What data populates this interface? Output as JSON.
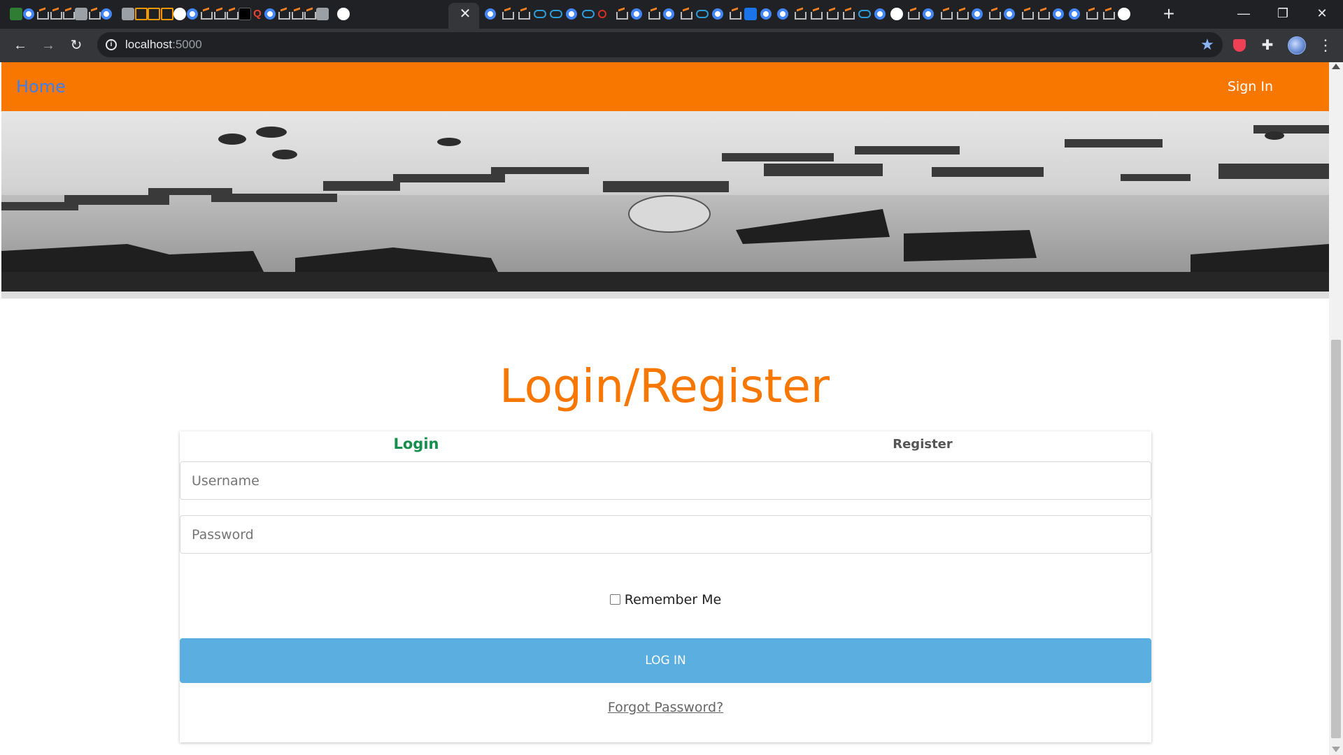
{
  "browser": {
    "url_host": "localhost",
    "url_port": ":5000",
    "tab_close_glyph": "✕",
    "new_tab_glyph": "+",
    "window_controls": {
      "minimize": "—",
      "restore": "❐",
      "close": "✕"
    },
    "toolbar_glyphs": {
      "back": "←",
      "forward": "→",
      "reload": "↻",
      "info": "i",
      "star": "★",
      "extensions": "✚",
      "menu": "⋮"
    }
  },
  "tabs": {
    "favicons": [
      "green-calendar-icon",
      "google-icon",
      "stackoverflow-icon",
      "stackoverflow-icon",
      "stackoverflow-icon",
      "grid-app-icon",
      "stackoverflow-icon",
      "google-icon",
      "arrow-app-icon",
      "orange-arc-icon",
      "hourglass-icon",
      "hourglass-icon",
      "chrome-icon",
      "google-icon",
      "stackoverflow-icon",
      "stackoverflow-icon",
      "stackoverflow-icon",
      "github-icon",
      "quora-icon",
      "google-icon",
      "stackoverflow-icon",
      "stackoverflow-icon",
      "stackoverflow-icon",
      "flag-app-icon",
      "chrome-icon",
      "google-icon",
      "stackoverflow-icon",
      "stackoverflow-icon",
      "link-app-icon",
      "link-app-icon",
      "google-icon",
      "link-app-icon",
      "record-icon",
      "stackoverflow-icon",
      "google-icon",
      "stackoverflow-icon",
      "google-icon",
      "stackoverflow-icon",
      "link-app-icon",
      "google-icon",
      "stackoverflow-icon",
      "cursor-app-icon",
      "google-icon",
      "google-icon",
      "stackoverflow-icon",
      "stackoverflow-icon",
      "stackoverflow-icon",
      "stackoverflow-icon",
      "link-app-icon",
      "google-icon",
      "pocket-app-icon",
      "stackoverflow-icon",
      "google-icon",
      "stackoverflow-icon",
      "stackoverflow-icon",
      "google-icon",
      "stackoverflow-icon",
      "google-icon",
      "stackoverflow-icon",
      "stackoverflow-icon",
      "google-icon",
      "google-icon",
      "stackoverflow-icon",
      "stackoverflow-icon",
      "medium-icon"
    ]
  },
  "nav": {
    "home_label": "Home",
    "signin_label": "Sign In"
  },
  "page": {
    "title": "Login/Register",
    "tabs": {
      "login": "Login",
      "register": "Register"
    },
    "username_placeholder": "Username",
    "password_placeholder": "Password",
    "remember_label": "Remember Me",
    "login_button": "LOG IN",
    "forgot_link": "Forgot Password?"
  },
  "colors": {
    "navbar": "#f77700",
    "title": "#f77700",
    "login_tab": "#168e4e",
    "login_button": "#5aafe0",
    "home_link": "#3d7ef0"
  }
}
